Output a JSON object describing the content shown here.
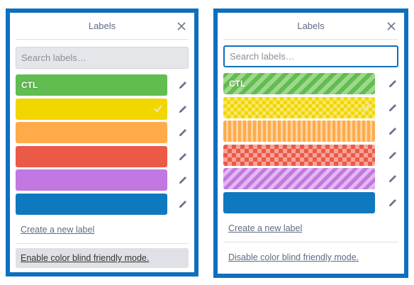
{
  "left_panel": {
    "title": "Labels",
    "search_placeholder": "Search labels…",
    "labels": [
      {
        "name": "CTL",
        "color": "#61bd4f",
        "selected": false
      },
      {
        "name": "",
        "color": "#f2d600",
        "selected": true
      },
      {
        "name": "",
        "color": "#ffab4a",
        "selected": false
      },
      {
        "name": "",
        "color": "#eb5a46",
        "selected": false
      },
      {
        "name": "",
        "color": "#c377e0",
        "selected": false
      },
      {
        "name": "",
        "color": "#0f79bf",
        "selected": false
      }
    ],
    "create_label_link": "Create a new label",
    "colorblind_toggle": "Enable color blind friendly mode."
  },
  "right_panel": {
    "title": "Labels",
    "search_placeholder": "Search labels…",
    "labels": [
      {
        "name": "CTL",
        "color": "#61bd4f",
        "pattern": "diagonal-stripes",
        "selected": false
      },
      {
        "name": "",
        "color": "#f2d600",
        "pattern": "checker",
        "selected": true
      },
      {
        "name": "",
        "color": "#ffab4a",
        "pattern": "vertical-stripes",
        "selected": false
      },
      {
        "name": "",
        "color": "#eb5a46",
        "pattern": "diamond-checker",
        "selected": false
      },
      {
        "name": "",
        "color": "#c377e0",
        "pattern": "diagonal-stripes",
        "selected": false
      },
      {
        "name": "",
        "color": "#0f79bf",
        "pattern": "solid",
        "selected": false
      }
    ],
    "create_label_link": "Create a new label",
    "colorblind_toggle": "Disable color blind friendly mode."
  },
  "colors": {
    "frame_border": "#0f6fbf",
    "muted_text": "#5e6c84"
  },
  "icons": {
    "close": "close-icon",
    "edit": "pencil-icon",
    "selected": "checkmark-icon"
  }
}
